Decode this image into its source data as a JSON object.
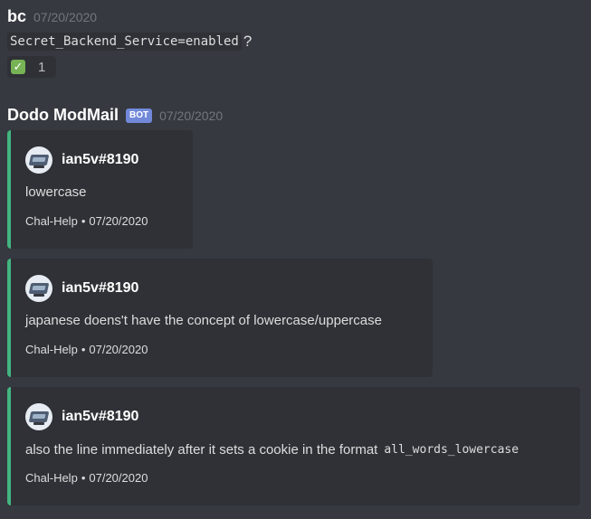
{
  "message1": {
    "username": "bc",
    "timestamp": "07/20/2020",
    "code": "Secret_Backend_Service=enabled",
    "trailing": "?",
    "reaction": {
      "emoji": "✅",
      "count": "1"
    }
  },
  "message2": {
    "username": "Dodo ModMail",
    "bot_tag": "BOT",
    "timestamp": "07/20/2020",
    "embeds": [
      {
        "author": "ian5v#8190",
        "description": "lowercase",
        "footer_channel": "Chal-Help",
        "footer_separator": "•",
        "footer_date": "07/20/2020"
      },
      {
        "author": "ian5v#8190",
        "description": "japanese doens't have the concept of lowercase/uppercase",
        "footer_channel": "Chal-Help",
        "footer_separator": "•",
        "footer_date": "07/20/2020"
      },
      {
        "author": "ian5v#8190",
        "description": "also the line immediately after it sets a cookie in the format",
        "description_code": "all_words_lowercase",
        "footer_channel": "Chal-Help",
        "footer_separator": "•",
        "footer_date": "07/20/2020"
      }
    ]
  },
  "colors": {
    "background": "#36393f",
    "embed_background": "#2f3136",
    "embed_accent": "#43b581",
    "bot_tag": "#7289da"
  },
  "icons": {
    "reaction": "check-mark-emoji",
    "avatar": "keyboard-avatar-icon"
  }
}
